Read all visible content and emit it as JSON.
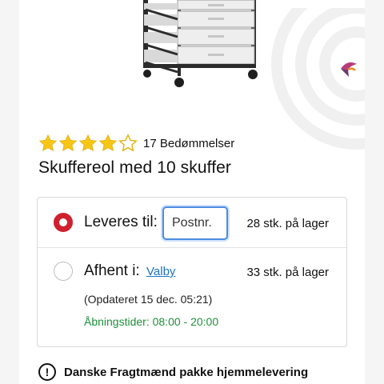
{
  "rating": {
    "stars_filled": 4,
    "stars_total": 5,
    "count_label": "17 Bedømmelser"
  },
  "product": {
    "title": "Skuffereol med 10 skuffer"
  },
  "delivery": {
    "deliver": {
      "label": "Leveres til:",
      "postcode_placeholder": "Postnr.",
      "postcode_value": "",
      "stock": "28 stk. på lager",
      "selected": true
    },
    "pickup": {
      "label": "Afhent i:",
      "store": "Valby",
      "stock": "33 stk. på lager",
      "updated": "(Opdateret 15 dec. 05:21)",
      "opening_hours": "Åbningstider: 08:00 - 20:00",
      "selected": false
    }
  },
  "info": {
    "text": "Danske Fragtmænd pakke hjemmelevering"
  },
  "colors": {
    "accent_red": "#d0202f",
    "link_blue": "#1d72c4",
    "open_green": "#1e8f3a",
    "star_yellow": "#f7c614",
    "focus_blue": "#4b8de0"
  }
}
